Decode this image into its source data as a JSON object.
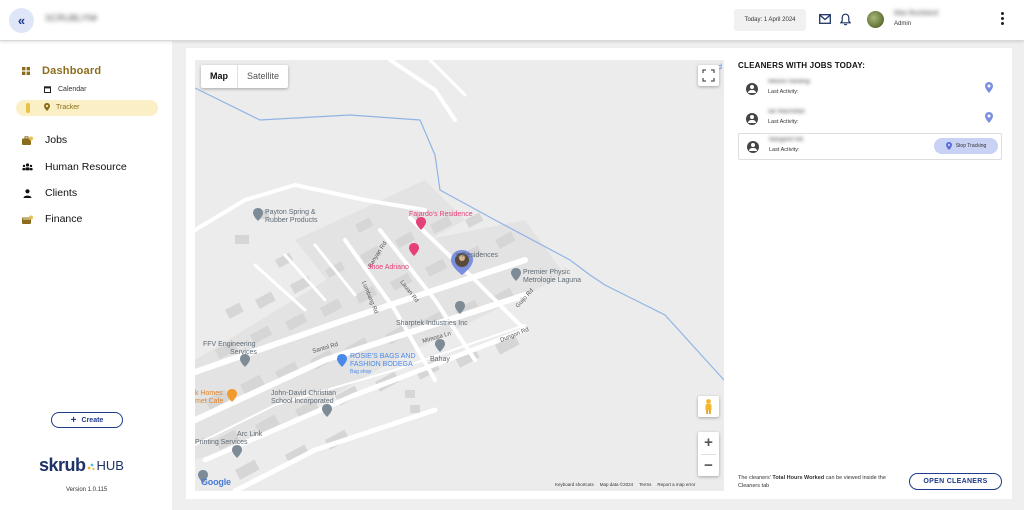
{
  "header": {
    "collapse_icon": "double-chevron-left-icon",
    "company_name": "SCRUBLYNK",
    "date_chip": "Today: 1 April 2024",
    "user_name": "Max Buckland",
    "user_role": "Admin"
  },
  "sidebar": {
    "dashboard": "Dashboard",
    "calendar": "Calendar",
    "tracker": "Tracker",
    "jobs": "Jobs",
    "human_resource": "Human Resource",
    "clients": "Clients",
    "finance": "Finance",
    "create": "Create",
    "logo_main": "skrub",
    "logo_hub": "HUB",
    "version": "Version 1.0.115"
  },
  "map": {
    "tab_map": "Map",
    "tab_satellite": "Satellite",
    "zoom_in": "+",
    "zoom_out": "−",
    "google": "Google",
    "footer_shortcuts": "Keyboard shortcuts",
    "footer_data": "Map data ©2024",
    "footer_terms": "Terms",
    "footer_report": "Report a map error",
    "places": {
      "payton": [
        "Payton Spring &",
        "Rubber Products"
      ],
      "fajardo": "Fajardo's Residence",
      "residences": "s Residences",
      "jhoe": "Jhoe Adriano",
      "premier": [
        "Premier Physic",
        "Metrologie Laguna"
      ],
      "sharptek": "Sharptek Industries Inc",
      "ffv": [
        "FFV Engineering",
        "Services"
      ],
      "rosie": [
        "ROSIE'S BAGS AND",
        "FASHION BODEGA"
      ],
      "bag_shop": "Bag shop",
      "bahay": "Bahay",
      "homes": [
        "k Homes",
        "met Cafe"
      ],
      "john": [
        "John-David Christian",
        "School Incorporated"
      ],
      "arclink": [
        "Arc Link",
        "Printing Services"
      ],
      "edge_d": "d"
    },
    "roads": {
      "banyan": "Banyan Rd",
      "lumbang": "Lumbang Rd",
      "lauan": "Lauan Rd",
      "guijo": "Guijo Rd",
      "dungon": "Dungon Rd",
      "mimosa": "Mimosa Ln",
      "santol": "Santol Rd"
    }
  },
  "cleaners": {
    "title": "CLEANERS WITH JOBS TODAY:",
    "last_activity": "Last Activity:",
    "stop_tracking": "Stop Tracking",
    "rows": [
      {
        "name": "Nelson Hardinger",
        "action": "location-pin-icon"
      },
      {
        "name": "Ian Macmillan",
        "action": "location-pin-icon"
      },
      {
        "name": "Margaret Hill",
        "action": "stop-tracking"
      }
    ],
    "footer_prefix": "The cleaners' ",
    "footer_bold": "Total Hours Worked",
    "footer_suffix": " can be viewed inside the Cleaners tab",
    "open_button": "OPEN CLEANERS"
  },
  "colors": {
    "navy": "#1e3a8a",
    "gold": "#8a6d1c",
    "tracker_bg": "#fbefc5",
    "stop_bg": "#c7d2f5",
    "pin_blue": "#7a8fe0",
    "pink": "#e6407a"
  }
}
